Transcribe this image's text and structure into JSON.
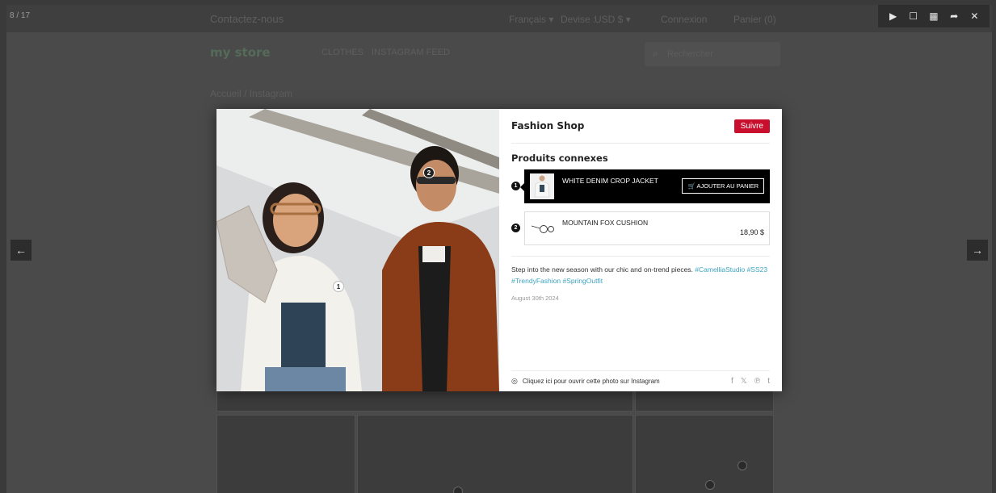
{
  "lightbox": {
    "counter": "8 / 17",
    "toolbar": {
      "play_icon": "▶",
      "fullscreen_icon": "☐",
      "thumbnails_icon": "▦",
      "share_icon": "➦",
      "close_icon": "✕"
    },
    "prev_icon": "←",
    "next_icon": "→"
  },
  "background": {
    "contact": "Contactez-nous",
    "language": "Français ▾",
    "currency_label": "Devise :",
    "currency": "USD $ ▾",
    "login": "Connexion",
    "cart": "Panier (0)",
    "logo": "my store",
    "nav": [
      "CLOTHES",
      "INSTAGRAM FEED"
    ],
    "search_placeholder": "Rechercher",
    "breadcrumb": "Accueil / Instagram"
  },
  "modal": {
    "shop_name": "Fashion Shop",
    "follow": "Suivre",
    "related_title": "Produits connexes",
    "products": [
      {
        "num": "1",
        "name": "WHITE DENIM CROP JACKET",
        "action": "AJOUTER AU PANIER",
        "price": ""
      },
      {
        "num": "2",
        "name": "MOUNTAIN FOX CUSHION",
        "action": "",
        "price": "18,90 $"
      }
    ],
    "caption_text": "Step into the new season with our chic and on-trend pieces. ",
    "hashtags": [
      "#CamelliaStudio",
      "#SS23",
      "#TrendyFashion",
      "#SpringOutfit"
    ],
    "date": "August 30th 2024",
    "instagram_link": "Cliquez ici pour ouvrir cette photo sur Instagram",
    "share_icons": [
      "f",
      "𝕏",
      "℗",
      "t"
    ],
    "hotspots": [
      "1",
      "2"
    ]
  },
  "colors": {
    "accent_red": "#c8102e",
    "hashtag_blue": "#3da4c2"
  }
}
